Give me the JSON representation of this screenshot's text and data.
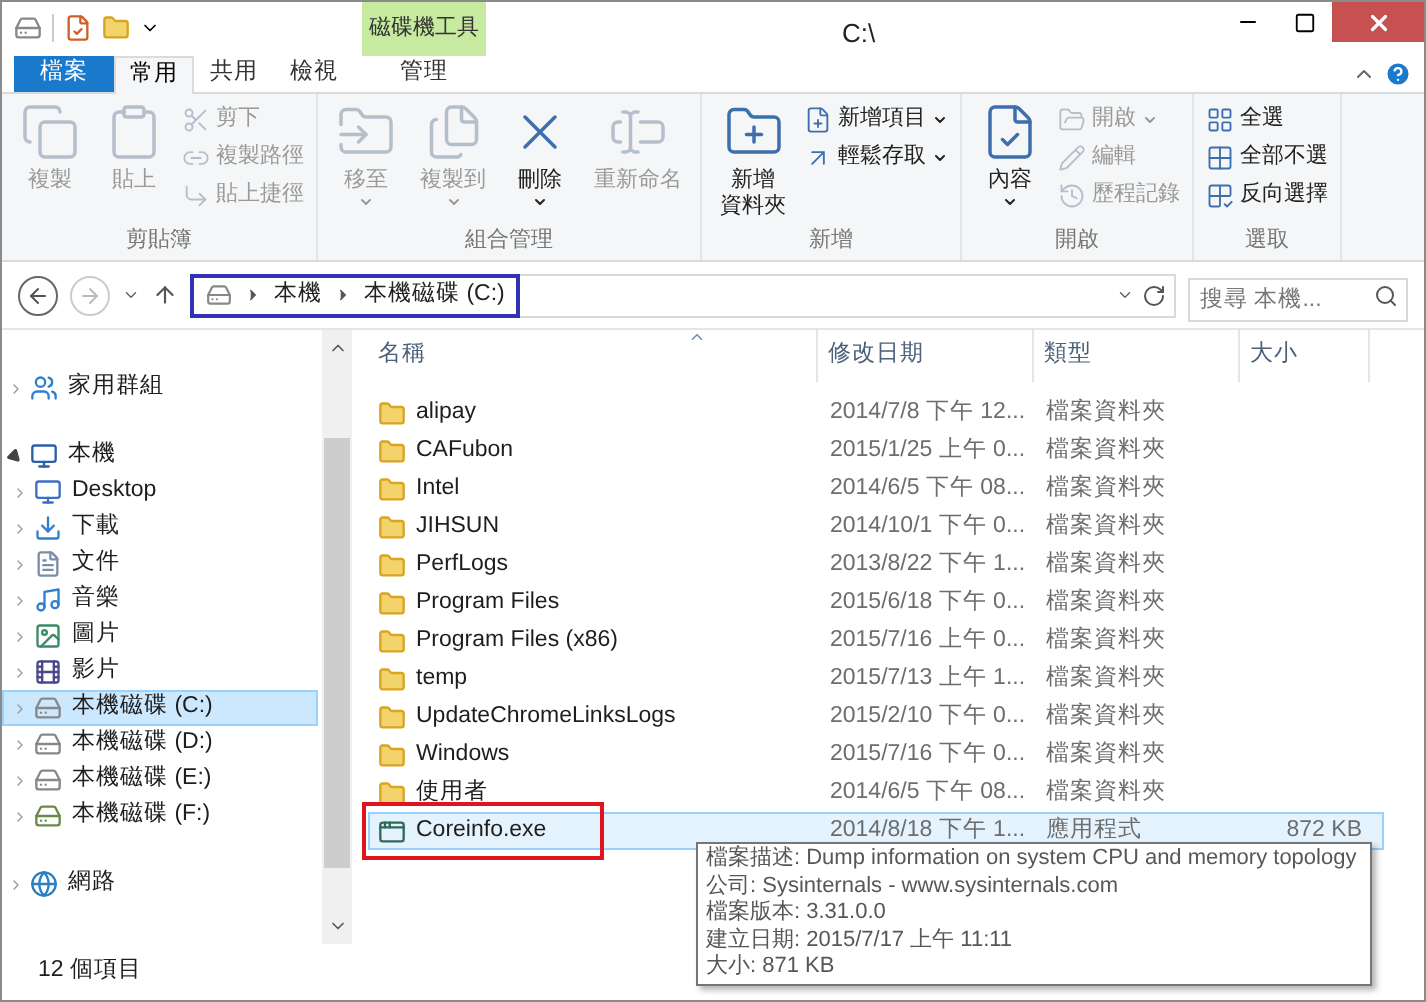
{
  "window": {
    "title": "C:\\",
    "context_tab_header": "磁碟機工具"
  },
  "tabs": [
    {
      "label": "檔案",
      "kind": "file",
      "selected": false
    },
    {
      "label": "常用",
      "kind": "tab",
      "selected": true
    },
    {
      "label": "共用",
      "kind": "tab",
      "selected": false
    },
    {
      "label": "檢視",
      "kind": "tab",
      "selected": false
    },
    {
      "label": "管理",
      "kind": "context",
      "selected": false
    }
  ],
  "ribbon": {
    "groups": [
      {
        "label": "剪貼簿",
        "items": [
          {
            "kind": "large",
            "label": "複製",
            "disabled": true,
            "dropdown": false
          },
          {
            "kind": "large",
            "label": "貼上",
            "disabled": true,
            "dropdown": false
          },
          {
            "kind": "small",
            "label": "剪下",
            "disabled": true,
            "dropdown": false
          },
          {
            "kind": "small",
            "label": "複製路徑",
            "disabled": true,
            "dropdown": false
          },
          {
            "kind": "small",
            "label": "貼上捷徑",
            "disabled": true,
            "dropdown": false
          }
        ]
      },
      {
        "label": "組合管理",
        "items": [
          {
            "kind": "large",
            "label": "移至",
            "disabled": true,
            "dropdown": true
          },
          {
            "kind": "large",
            "label": "複製到",
            "disabled": true,
            "dropdown": true
          },
          {
            "kind": "large",
            "label": "刪除",
            "disabled": false,
            "dropdown": true
          },
          {
            "kind": "large",
            "label": "重新命名",
            "disabled": true,
            "dropdown": false
          }
        ]
      },
      {
        "label": "新增",
        "items": [
          {
            "kind": "large",
            "label_lines": [
              "新增",
              "資料夾"
            ],
            "disabled": false,
            "dropdown": false
          },
          {
            "kind": "small",
            "label": "新增項目",
            "disabled": false,
            "dropdown": true
          },
          {
            "kind": "small",
            "label": "輕鬆存取",
            "disabled": false,
            "dropdown": true
          }
        ]
      },
      {
        "label": "開啟",
        "items": [
          {
            "kind": "large",
            "label": "內容",
            "disabled": false,
            "dropdown": true
          },
          {
            "kind": "small",
            "label": "開啟",
            "disabled": true,
            "dropdown": true
          },
          {
            "kind": "small",
            "label": "編輯",
            "disabled": true,
            "dropdown": false
          },
          {
            "kind": "small",
            "label": "歷程記錄",
            "disabled": true,
            "dropdown": false
          }
        ]
      },
      {
        "label": "選取",
        "items": [
          {
            "kind": "small",
            "label": "全選",
            "disabled": false,
            "dropdown": false
          },
          {
            "kind": "small",
            "label": "全部不選",
            "disabled": false,
            "dropdown": false
          },
          {
            "kind": "small",
            "label": "反向選擇",
            "disabled": false,
            "dropdown": false
          }
        ]
      }
    ]
  },
  "address": {
    "breadcrumb": [
      "本機",
      "本機磁碟 (C:)"
    ],
    "search_placeholder": "搜尋 本機..."
  },
  "navigation": [
    {
      "label": "家用群組",
      "kind": "homegroup",
      "expanded": false,
      "selected": false
    },
    {
      "label": "本機",
      "kind": "computer",
      "expanded": true,
      "selected": false,
      "children": [
        {
          "label": "Desktop",
          "kind": "desktop",
          "expanded": false,
          "selected": false
        },
        {
          "label": "下載",
          "kind": "downloads",
          "expanded": false,
          "selected": false
        },
        {
          "label": "文件",
          "kind": "documents",
          "expanded": false,
          "selected": false
        },
        {
          "label": "音樂",
          "kind": "music",
          "expanded": false,
          "selected": false
        },
        {
          "label": "圖片",
          "kind": "pictures",
          "expanded": false,
          "selected": false
        },
        {
          "label": "影片",
          "kind": "videos",
          "expanded": false,
          "selected": false
        },
        {
          "label": "本機磁碟 (C:)",
          "kind": "drive",
          "expanded": false,
          "selected": true
        },
        {
          "label": "本機磁碟 (D:)",
          "kind": "drive",
          "expanded": false,
          "selected": false
        },
        {
          "label": "本機磁碟 (E:)",
          "kind": "drive",
          "expanded": false,
          "selected": false
        },
        {
          "label": "本機磁碟 (F:)",
          "kind": "netdrive",
          "expanded": false,
          "selected": false
        }
      ]
    },
    {
      "label": "網路",
      "kind": "network",
      "expanded": false,
      "selected": false
    }
  ],
  "table": {
    "columns": [
      "名稱",
      "修改日期",
      "類型",
      "大小"
    ],
    "rows": [
      {
        "kind": "folder",
        "name": "alipay",
        "date": "2014/7/8 下午 12...",
        "type": "檔案資料夾",
        "selected": false
      },
      {
        "kind": "folder",
        "name": "CAFubon",
        "date": "2015/1/25 上午 0...",
        "type": "檔案資料夾",
        "selected": false
      },
      {
        "kind": "folder",
        "name": "Intel",
        "date": "2014/6/5 下午 08...",
        "type": "檔案資料夾",
        "selected": false
      },
      {
        "kind": "folder",
        "name": "JIHSUN",
        "date": "2014/10/1 下午 0...",
        "type": "檔案資料夾",
        "selected": false
      },
      {
        "kind": "folder",
        "name": "PerfLogs",
        "date": "2013/8/22 下午 1...",
        "type": "檔案資料夾",
        "selected": false
      },
      {
        "kind": "folder",
        "name": "Program Files",
        "date": "2015/6/18 下午 0...",
        "type": "檔案資料夾",
        "selected": false
      },
      {
        "kind": "folder",
        "name": "Program Files (x86)",
        "date": "2015/7/16 上午 0...",
        "type": "檔案資料夾",
        "selected": false
      },
      {
        "kind": "folder",
        "name": "temp",
        "date": "2015/7/13 上午 1...",
        "type": "檔案資料夾",
        "selected": false
      },
      {
        "kind": "folder",
        "name": "UpdateChromeLinksLogs",
        "date": "2015/2/10 下午 0...",
        "type": "檔案資料夾",
        "selected": false
      },
      {
        "kind": "folder",
        "name": "Windows",
        "date": "2015/7/16 下午 0...",
        "type": "檔案資料夾",
        "selected": false
      },
      {
        "kind": "folder",
        "name": "使用者",
        "date": "2014/6/5 下午 08...",
        "type": "檔案資料夾",
        "selected": false
      },
      {
        "kind": "exe",
        "name": "Coreinfo.exe",
        "date": "2014/8/18 下午 1...",
        "type": "應用程式",
        "size": "872 KB",
        "selected": true
      }
    ]
  },
  "tooltip": {
    "lines": [
      "檔案描述: Dump information on system CPU and memory topology",
      "公司: Sysinternals - www.sysinternals.com",
      "檔案版本: 3.31.0.0",
      "建立日期: 2015/7/17 上午 11:11",
      "大小: 871 KB"
    ]
  },
  "status_bar": {
    "item_count": "12 個項目"
  }
}
